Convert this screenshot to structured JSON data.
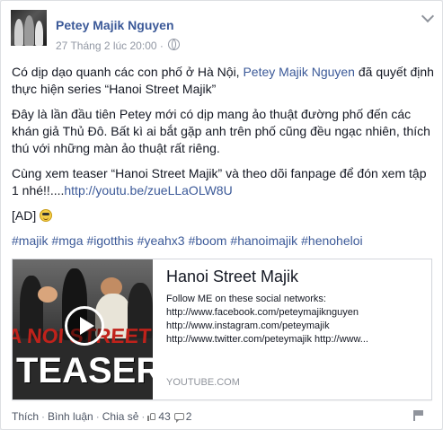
{
  "post": {
    "author": "Petey Majik Nguyen",
    "timestamp": "27 Tháng 2 lúc 20:00",
    "paragraphs": {
      "p1_before": "Có dịp dạo quanh các con phố ở Hà Nội, ",
      "p1_mention": "Petey Majik Nguyen",
      "p1_after": " đã quyết định thực hiện series “Hanoi Street Majik”",
      "p2": "Đây là lần đầu tiên Petey mới có dịp mang ảo thuật đường phố đến các khán giả Thủ Đô. Bất kì ai bắt gặp anh trên phố cũng đều ngạc nhiên, thích thú với những màn ảo thuật rất riêng.",
      "p3_before": "Cùng xem teaser “Hanoi Street Majik” và theo dõi fanpage để đón xem tập 1 nhé!!....",
      "p3_link": "http://youtu.be/zueLLaOLW8U",
      "p4": "[AD]"
    },
    "hashtags": [
      "#majik",
      "#mga",
      "#igotthis",
      "#yeahx3",
      "#boom",
      "#hanoimajik",
      "#henoheloi"
    ]
  },
  "share": {
    "thumbnail_text_top": "A NOI STREET MAJIK",
    "thumbnail_text_bottom": "TEASER",
    "title": "Hanoi Street Majik",
    "desc_lines": [
      "Follow ME on these social networks:",
      "http://www.facebook.com/peteymajiknguyen",
      "http://www.instagram.com/peteymajik",
      "http://www.twitter.com/peteymajik http://www..."
    ],
    "source": "YOUTUBE.COM"
  },
  "actions": {
    "like": "Thích",
    "comment": "Bình luận",
    "share": "Chia sẻ",
    "like_count": "43",
    "comment_count": "2"
  },
  "icons": {
    "globe": "globe-icon",
    "emoji": "cool-emoji-icon",
    "play": "play-icon",
    "like": "thumbs-up-icon",
    "comment": "comment-icon",
    "flag": "flag-icon"
  },
  "colors": {
    "link": "#3b5998",
    "text": "#141823",
    "muted": "#9197a3"
  }
}
